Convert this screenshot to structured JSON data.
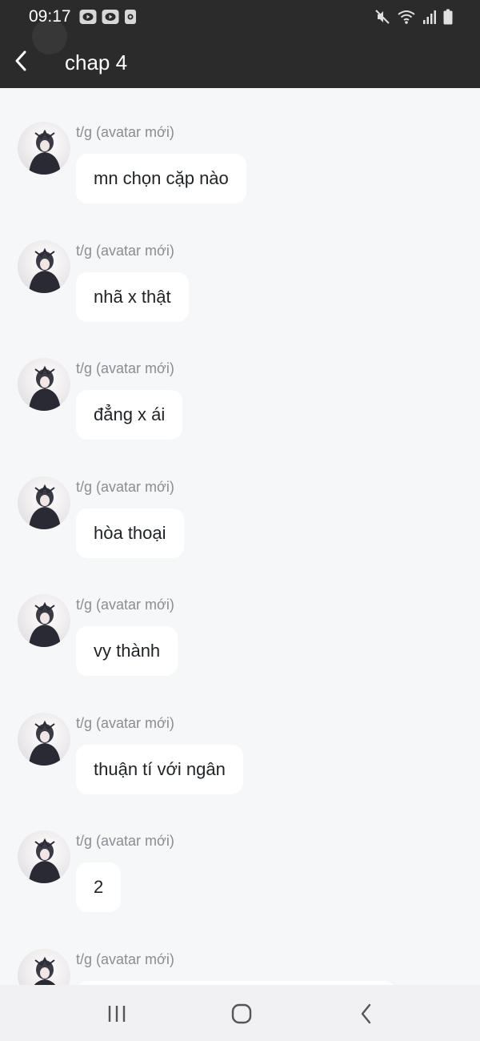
{
  "status_bar": {
    "time": "09:17",
    "notification_icons": [
      "youtube-icon",
      "youtube-icon",
      "camera-app-icon"
    ],
    "system_icons": [
      "mute-icon",
      "wifi-icon",
      "signal-icon",
      "battery-icon"
    ]
  },
  "header": {
    "title": "chap 4",
    "background": "#2b2b2b"
  },
  "messages": [
    {
      "sender": "t/g (avatar mới)",
      "text": "mn chọn cặp nào"
    },
    {
      "sender": "t/g (avatar mới)",
      "text": "nhã x thật"
    },
    {
      "sender": "t/g (avatar mới)",
      "text": "đẳng x ái"
    },
    {
      "sender": "t/g (avatar mới)",
      "text": "hòa thoại"
    },
    {
      "sender": "t/g (avatar mới)",
      "text": "vy thành"
    },
    {
      "sender": "t/g (avatar mới)",
      "text": "thuận tí với ngân"
    },
    {
      "sender": "t/g (avatar mới)",
      "text": "2"
    },
    {
      "sender": "t/g (avatar mới)",
      "text": ""
    }
  ],
  "nav_bar": {
    "buttons": [
      "recent-apps-icon",
      "home-icon",
      "back-icon"
    ]
  }
}
